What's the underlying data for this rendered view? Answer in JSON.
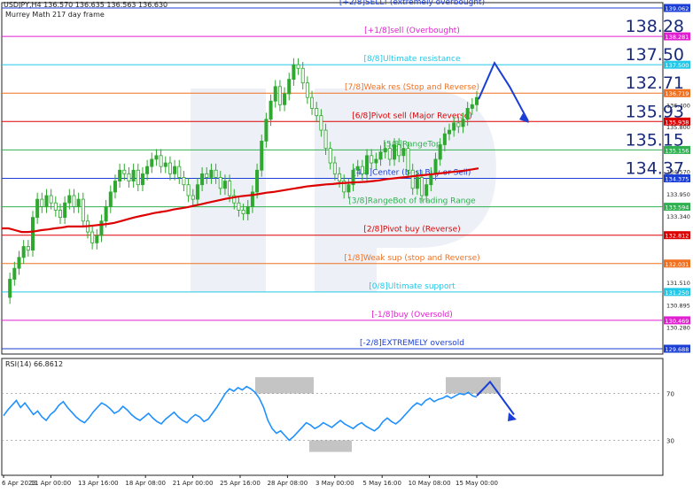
{
  "header": {
    "symbol_line": "USDJPY,H4  136.570 136.635 136.563 136.630",
    "indicator": "Murrey Math 217 day frame"
  },
  "rsi_label": "RSI(14) 66.8612",
  "colors": {
    "candle": "#2ea82e",
    "ma": "#dd0000",
    "rsi": "#1e90ff",
    "arrow": "#1a3ed6",
    "grid": "#222222"
  },
  "chart_data": {
    "type": "line",
    "title": "USDJPY,H4",
    "price_range": [
      129.688,
      139.062
    ],
    "x_tick_labels": [
      "6 Apr 2023",
      "11 Apr 00:00",
      "13 Apr 16:00",
      "18 Apr 08:00",
      "21 Apr 00:00",
      "25 Apr 16:00",
      "28 Apr 08:00",
      "3 May 00:00",
      "5 May 16:00",
      "10 May 08:00",
      "15 May 00:00"
    ],
    "y_tick_labels": [
      "139.062",
      "138.281",
      "137.500",
      "136.719",
      "136.400",
      "135.938",
      "135.800",
      "135.156",
      "134.570",
      "134.375",
      "133.950",
      "133.594",
      "133.340",
      "132.812",
      "132.031",
      "131.510",
      "131.250",
      "130.895",
      "130.469",
      "130.280",
      "129.688"
    ],
    "murrey_levels": [
      {
        "label": "[+2/8]SELL! (extremely overbought)",
        "price": 139.062,
        "color": "#1a3ed6",
        "big": ""
      },
      {
        "label": "[+1/8]sell (Overbought)",
        "price": 138.281,
        "color": "#e020d0",
        "big": "138.28"
      },
      {
        "label": "[8/8]Ultimate resistance",
        "price": 137.5,
        "color": "#22c8e8",
        "big": "137.50"
      },
      {
        "label": "[7/8]Weak res (Stop and Reverse)",
        "price": 136.719,
        "color": "#f07020",
        "big": "132.71"
      },
      {
        "label": "[6/8]Pivot sell (Major Reverse)",
        "price": 135.938,
        "color": "#dd0000",
        "big": "135.93"
      },
      {
        "label": "[5/8]RangeTop",
        "price": 135.156,
        "color": "#30b050",
        "big": "135.15"
      },
      {
        "label": "[4/8]Center (Best Buy or Sell)",
        "price": 134.375,
        "color": "#1a3ed6",
        "big": "134.37"
      },
      {
        "label": "[3/8]RangeBot of trading Range",
        "price": 133.594,
        "color": "#30b050",
        "big": ""
      },
      {
        "label": "[2/8]Pivot buy (Reverse)",
        "price": 132.812,
        "color": "#dd0000",
        "big": ""
      },
      {
        "label": "[1/8]Weak sup (stop and Reverse)",
        "price": 132.031,
        "color": "#f07020",
        "big": ""
      },
      {
        "label": "[0/8]Ultimate support",
        "price": 131.25,
        "color": "#22c8e8",
        "big": ""
      },
      {
        "label": "[-1/8]buy (Oversold)",
        "price": 130.469,
        "color": "#e020d0",
        "big": ""
      },
      {
        "label": "[-2/8]EXTREMELY oversold",
        "price": 129.688,
        "color": "#1a3ed6",
        "big": ""
      }
    ],
    "price_series": [
      {
        "name": "USDJPY",
        "values": [
          131.1,
          131.6,
          131.9,
          132.2,
          132.5,
          132.4,
          133.3,
          133.8,
          133.6,
          133.9,
          133.7,
          133.5,
          133.3,
          133.7,
          133.9,
          133.6,
          133.8,
          133.2,
          132.9,
          132.6,
          132.8,
          133.2,
          133.6,
          134.0,
          134.3,
          134.6,
          134.5,
          134.3,
          134.6,
          134.2,
          134.5,
          134.7,
          134.9,
          135.0,
          134.7,
          134.8,
          134.5,
          134.7,
          134.4,
          134.2,
          133.9,
          133.8,
          134.2,
          134.5,
          134.4,
          134.6,
          134.4,
          134.1,
          134.3,
          133.9,
          133.7,
          133.5,
          133.4,
          133.6,
          134.0,
          134.6,
          135.4,
          136.0,
          136.5,
          136.9,
          136.4,
          136.7,
          137.1,
          137.5,
          137.4,
          137.0,
          136.6,
          136.3,
          136.1,
          135.7,
          135.2,
          134.8,
          134.5,
          134.3,
          134.0,
          134.2,
          134.6,
          134.7,
          134.5,
          135.0,
          134.8,
          134.9,
          135.1,
          135.2,
          134.9,
          135.3,
          135.0,
          135.2,
          134.6,
          134.1,
          134.4,
          133.9,
          134.2,
          134.5,
          134.9,
          135.3,
          135.6,
          135.7,
          135.9,
          135.8,
          136.0,
          136.3,
          136.4,
          136.6
        ]
      },
      {
        "name": "MA",
        "values": [
          133.0,
          133.0,
          132.95,
          132.9,
          132.9,
          132.92,
          132.95,
          132.97,
          133.0,
          133.02,
          133.05,
          133.05,
          133.05,
          133.06,
          133.08,
          133.1,
          133.12,
          133.15,
          133.2,
          133.25,
          133.3,
          133.34,
          133.38,
          133.42,
          133.45,
          133.48,
          133.52,
          133.55,
          133.58,
          133.62,
          133.66,
          133.7,
          133.74,
          133.78,
          133.82,
          133.85,
          133.88,
          133.9,
          133.92,
          133.95,
          133.98,
          134.0,
          134.03,
          134.06,
          134.09,
          134.12,
          134.15,
          134.17,
          134.19,
          134.21,
          134.22,
          134.24,
          134.25,
          134.26,
          134.27,
          134.28,
          134.3,
          134.32,
          134.35,
          134.37,
          134.39,
          134.41,
          134.43,
          134.45,
          134.47,
          134.49,
          134.51,
          134.53,
          134.55,
          134.57,
          134.59,
          134.62,
          134.65
        ]
      }
    ],
    "rsi": {
      "name": "RSI(14)",
      "y_ticks": [
        30,
        70
      ],
      "range": [
        0,
        100
      ],
      "values": [
        51,
        56,
        60,
        64,
        58,
        62,
        57,
        52,
        55,
        50,
        47,
        52,
        55,
        60,
        63,
        58,
        54,
        50,
        47,
        45,
        49,
        54,
        58,
        62,
        60,
        57,
        53,
        55,
        59,
        56,
        52,
        49,
        47,
        50,
        53,
        49,
        46,
        44,
        48,
        51,
        54,
        50,
        47,
        45,
        49,
        52,
        50,
        46,
        48,
        53,
        58,
        64,
        70,
        74,
        72,
        75,
        73,
        76,
        74,
        71,
        66,
        58,
        47,
        40,
        36,
        38,
        34,
        30,
        33,
        37,
        41,
        45,
        43,
        40,
        42,
        45,
        43,
        41,
        44,
        47,
        44,
        42,
        40,
        43,
        45,
        42,
        40,
        38,
        41,
        46,
        49,
        46,
        44,
        47,
        51,
        55,
        59,
        62,
        60,
        64,
        66,
        63,
        65,
        66,
        68,
        66,
        68,
        70,
        69,
        71,
        68,
        67
      ]
    },
    "forecast": "up to 137.50 then down toward 135.93"
  }
}
